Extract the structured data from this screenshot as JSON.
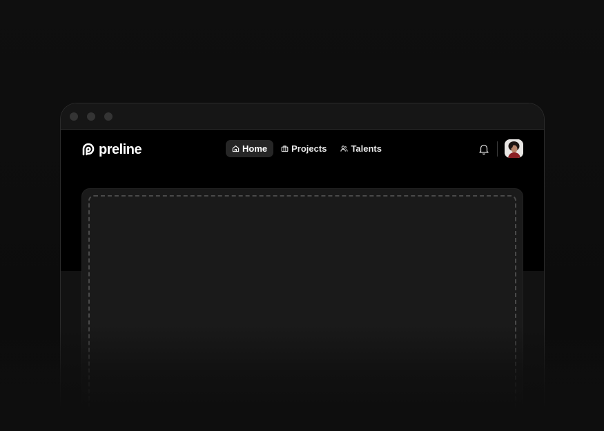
{
  "brand": {
    "name": "preline"
  },
  "nav": {
    "items": [
      {
        "label": "Home",
        "icon": "home-icon",
        "active": true
      },
      {
        "label": "Projects",
        "icon": "briefcase-icon",
        "active": false
      },
      {
        "label": "Talents",
        "icon": "users-icon",
        "active": false
      }
    ]
  },
  "colors": {
    "background": "#0e0e0e",
    "window_bg": "#000000",
    "titlebar_bg": "#161616",
    "active_nav_bg": "#262626",
    "panel_bg": "#1a1a1a",
    "text": "#ffffff"
  },
  "icons": {
    "notifications": "bell-icon",
    "profile": "avatar"
  }
}
